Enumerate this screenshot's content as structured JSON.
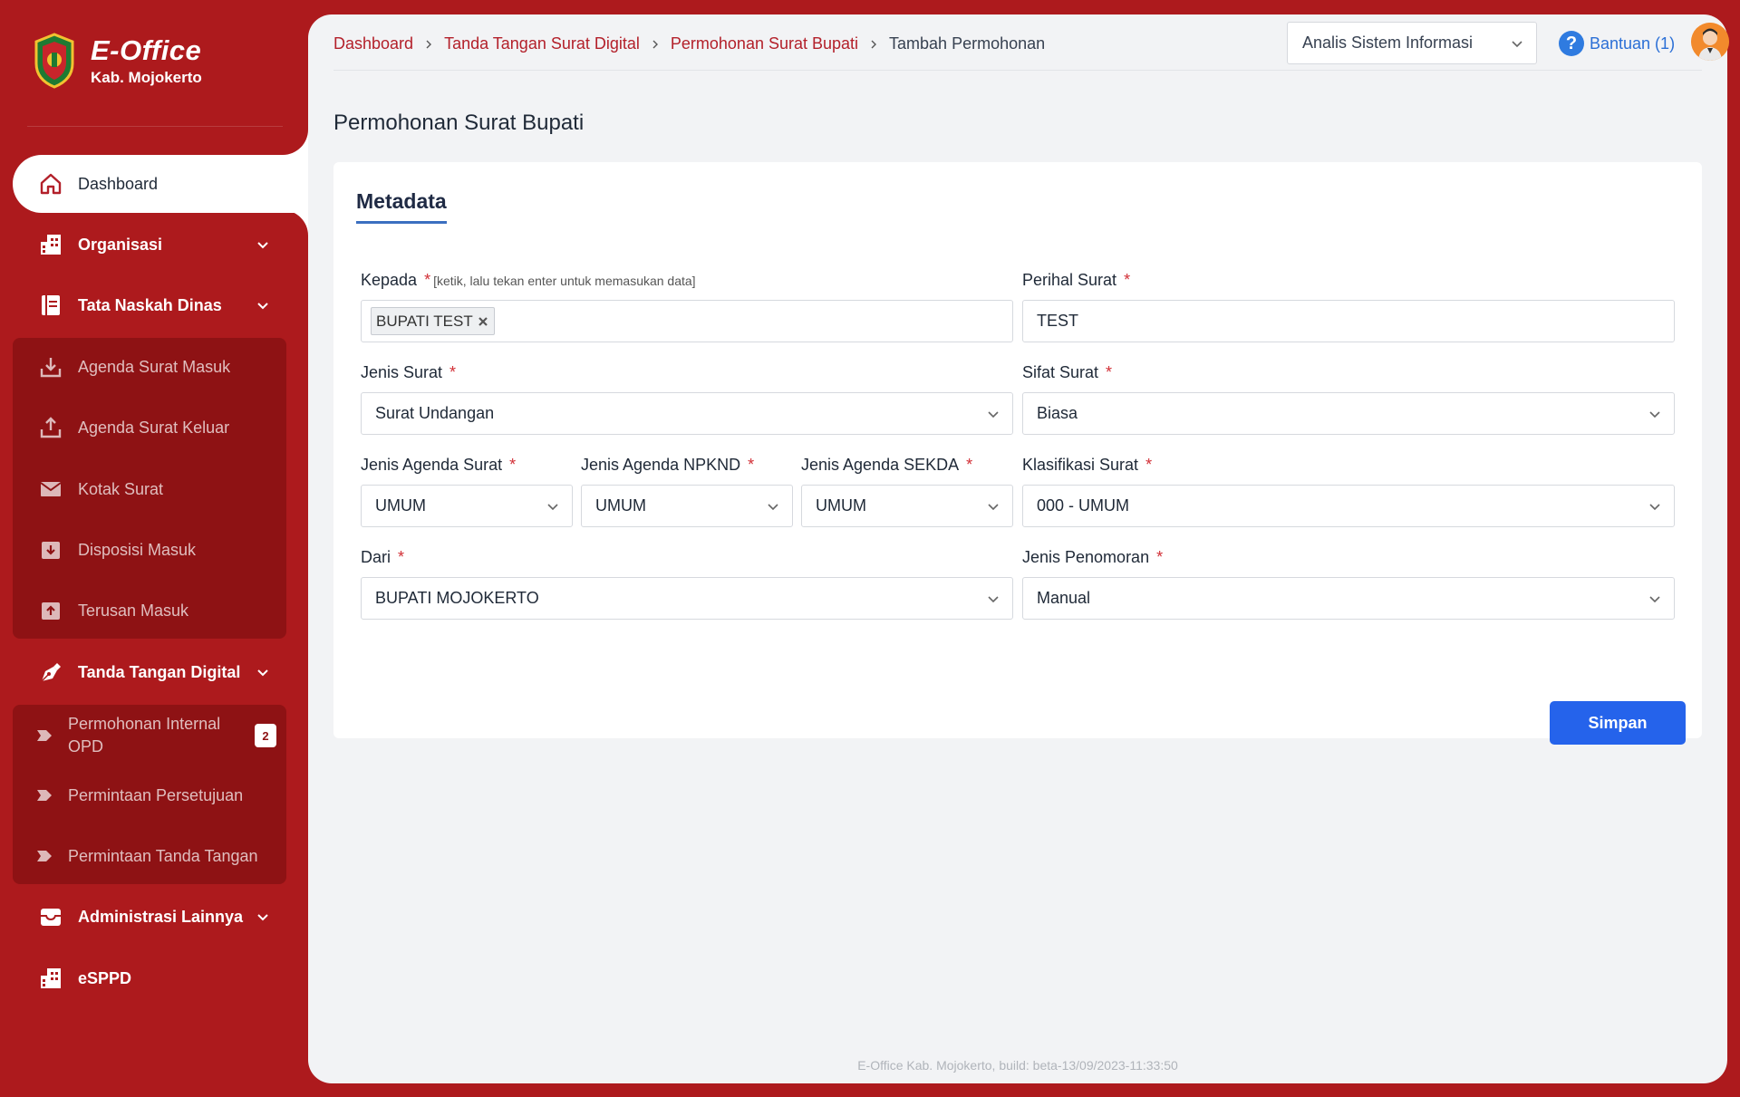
{
  "brand": {
    "title": "E-Office",
    "subtitle": "Kab. Mojokerto"
  },
  "sidebar": {
    "items": [
      {
        "label": "Dashboard"
      },
      {
        "label": "Organisasi"
      },
      {
        "label": "Tata Naskah Dinas"
      },
      {
        "label": "Agenda Surat Masuk"
      },
      {
        "label": "Agenda Surat Keluar"
      },
      {
        "label": "Kotak Surat"
      },
      {
        "label": "Disposisi Masuk"
      },
      {
        "label": "Terusan Masuk"
      },
      {
        "label": "Tanda Tangan Digital"
      },
      {
        "label_line1": "Permohonan Internal",
        "label_line2": "OPD",
        "badge": "2"
      },
      {
        "label": "Permintaan Persetujuan"
      },
      {
        "label": "Permintaan Tanda Tangan"
      },
      {
        "label": "Administrasi Lainnya"
      },
      {
        "label": "eSPPD"
      }
    ]
  },
  "breadcrumb": [
    "Dashboard",
    "Tanda Tangan Surat Digital",
    "Permohonan Surat Bupati",
    "Tambah Permohonan"
  ],
  "header": {
    "role": "Analis Sistem Informasi",
    "help": "Bantuan (1)"
  },
  "page": {
    "title": "Permohonan Surat Bupati"
  },
  "form": {
    "tab": "Metadata",
    "required_mark": "*",
    "kepada": {
      "label": "Kepada",
      "hint": "[ketik, lalu tekan enter untuk memasukan data]",
      "tags": [
        "BUPATI TEST"
      ]
    },
    "perihal": {
      "label": "Perihal Surat",
      "value": "TEST"
    },
    "jenis_surat": {
      "label": "Jenis Surat",
      "value": "Surat Undangan"
    },
    "sifat_surat": {
      "label": "Sifat Surat",
      "value": "Biasa"
    },
    "jenis_agenda_surat": {
      "label": "Jenis Agenda Surat",
      "value": "UMUM"
    },
    "jenis_agenda_npknd": {
      "label": "Jenis Agenda NPKND",
      "value": "UMUM"
    },
    "jenis_agenda_sekda": {
      "label": "Jenis Agenda SEKDA",
      "value": "UMUM"
    },
    "klasifikasi": {
      "label": "Klasifikasi Surat",
      "value": "000 - UMUM"
    },
    "dari": {
      "label": "Dari",
      "value": "BUPATI MOJOKERTO"
    },
    "penomoran": {
      "label": "Jenis Penomoran",
      "value": "Manual"
    },
    "save_label": "Simpan"
  },
  "footer": "E-Office Kab. Mojokerto, build: beta-13/09/2023-11:33:50",
  "colors": {
    "sidebar": "#ad1a1d",
    "submenu": "#8e1214",
    "accent": "#2563eb",
    "link": "#b3202a"
  }
}
